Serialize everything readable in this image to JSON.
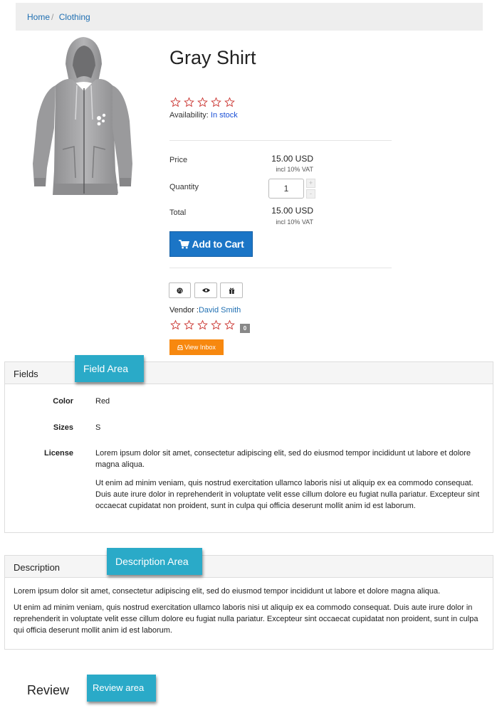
{
  "breadcrumb": {
    "home": "Home",
    "separator": "/",
    "category": "Clothing"
  },
  "product": {
    "title": "Gray Shirt",
    "image_icon": "hoodie-image",
    "rating": 0,
    "availability_label": "Availability:",
    "availability_value": "In stock",
    "price_label": "Price",
    "price_value": "15.00 USD",
    "price_vat": "incl 10% VAT",
    "quantity_label": "Quantity",
    "quantity_value": "1",
    "qty_plus": "+",
    "qty_minus": "-",
    "total_label": "Total",
    "total_value": "15.00 USD",
    "total_vat": "incl 10% VAT",
    "add_to_cart": "Add to Cart",
    "action_icons": [
      "globe-icon",
      "eye-icon",
      "gift-icon"
    ],
    "vendor_label": "Vendor :",
    "vendor_name": "David Smith",
    "vendor_rating": 0,
    "vendor_review_count": "0",
    "view_inbox": "View Inbox"
  },
  "fields_panel": {
    "title": "Fields",
    "rows": [
      {
        "label": "Color",
        "value": "Red"
      },
      {
        "label": "Sizes",
        "value": "S"
      },
      {
        "label": "License",
        "paragraphs": [
          "Lorem ipsum dolor sit amet, consectetur adipiscing elit, sed do eiusmod tempor incididunt ut labore et dolore magna aliqua.",
          "Ut enim ad minim veniam, quis nostrud exercitation ullamco laboris nisi ut aliquip ex ea commodo consequat. Duis aute irure dolor in reprehenderit in voluptate velit esse cillum dolore eu fugiat nulla pariatur. Excepteur sint occaecat cupidatat non proident, sunt in culpa qui officia deserunt mollit anim id est laborum."
        ]
      }
    ]
  },
  "description_panel": {
    "title": "Description",
    "paragraphs": [
      "Lorem ipsum dolor sit amet, consectetur adipiscing elit, sed do eiusmod tempor incididunt ut labore et dolore magna aliqua.",
      "Ut enim ad minim veniam, quis nostrud exercitation ullamco laboris nisi ut aliquip ex ea commodo consequat. Duis aute irure dolor in reprehenderit in voluptate velit esse cillum dolore eu fugiat nulla pariatur. Excepteur sint occaecat cupidatat non proident, sunt in culpa qui officia deserunt mollit anim id est laborum."
    ]
  },
  "review": {
    "title": "Review"
  },
  "annotations": {
    "field_area": "Field Area",
    "description_area": "Description Area",
    "review_area": "Review area"
  },
  "colors": {
    "link": "#1f6fb2",
    "primary_button": "#1b75c6",
    "inbox_button": "#f7880f",
    "annotation": "#2aaac8",
    "star_outline": "#c9302c"
  }
}
